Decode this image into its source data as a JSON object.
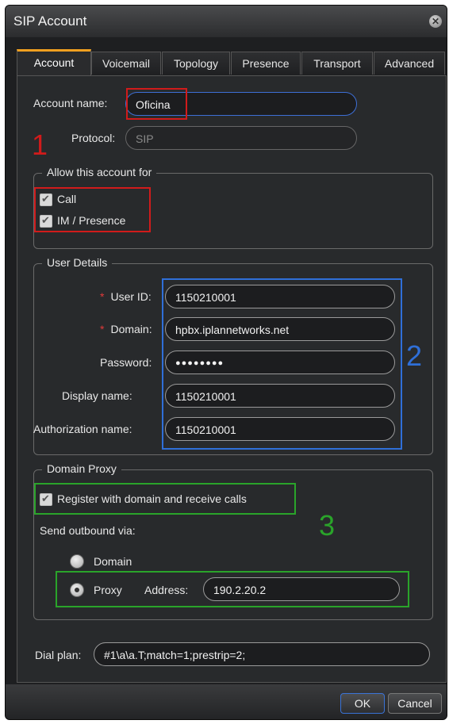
{
  "window": {
    "title": "SIP Account"
  },
  "tabs": [
    {
      "label": "Account",
      "active": true
    },
    {
      "label": "Voicemail"
    },
    {
      "label": "Topology"
    },
    {
      "label": "Presence"
    },
    {
      "label": "Transport"
    },
    {
      "label": "Advanced"
    }
  ],
  "account": {
    "name_label": "Account name:",
    "name_value": "Oficina",
    "protocol_label": "Protocol:",
    "protocol_value": "SIP"
  },
  "allow": {
    "legend": "Allow this account for",
    "call_label": "Call",
    "im_label": "IM / Presence"
  },
  "user_details": {
    "legend": "User Details",
    "required_mark": "*",
    "user_id_label": "User ID:",
    "user_id_value": "1150210001",
    "domain_label": "Domain:",
    "domain_value": "hpbx.iplannetworks.net",
    "password_label": "Password:",
    "password_value": "●●●●●●●●",
    "display_name_label": "Display name:",
    "display_name_value": "1150210001",
    "auth_name_label": "Authorization name:",
    "auth_name_value": "1150210001"
  },
  "proxy": {
    "legend": "Domain Proxy",
    "register_label": "Register with domain and receive calls",
    "send_label": "Send outbound via:",
    "domain_option": "Domain",
    "proxy_option": "Proxy",
    "address_label": "Address:",
    "address_value": "190.2.20.2"
  },
  "dial_plan": {
    "label": "Dial plan:",
    "value": "#1\\a\\a.T;match=1;prestrip=2;"
  },
  "annotations": {
    "n1": "1",
    "n2": "2",
    "n3": "3"
  },
  "buttons": {
    "ok": "OK",
    "cancel": "Cancel"
  },
  "colors": {
    "accent_tab": "#f0a020",
    "annotation_red": "#d11b1b",
    "annotation_blue": "#2f6fd8",
    "annotation_green": "#2aa42a"
  }
}
